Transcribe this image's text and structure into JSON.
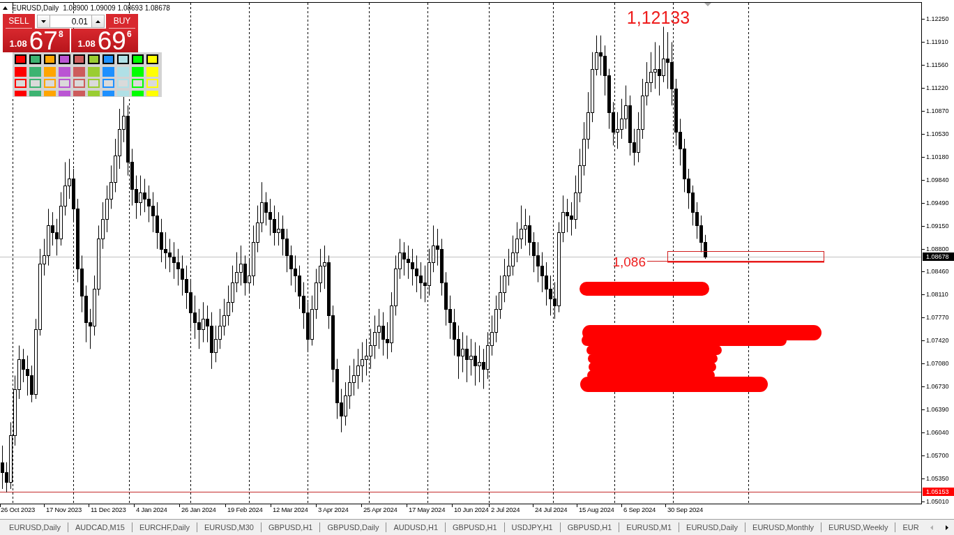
{
  "chart_header": {
    "symbol": "EURUSD,Daily",
    "ohlc": [
      "1.08900",
      "1.09009",
      "1.08693",
      "1.08678"
    ]
  },
  "one_click_trading": {
    "sell": {
      "label": "SELL",
      "price_prefix": "1.08",
      "price_main": "67",
      "price_fraction": "8"
    },
    "lot": {
      "value": "0.01"
    },
    "buy": {
      "label": "BUY",
      "price_prefix": "1.08",
      "price_main": "69",
      "price_fraction": "6"
    }
  },
  "palette": {
    "swatches": [
      {
        "color": "#ff0000"
      },
      {
        "color": "#3cb371"
      },
      {
        "color": "#ffa500"
      },
      {
        "color": "#ba55d3"
      },
      {
        "color": "#cd5c5c"
      },
      {
        "color": "#9acd32"
      },
      {
        "color": "#1e90ff"
      },
      {
        "color": "#b0e0e6"
      },
      {
        "color": "#00ff00"
      },
      {
        "color": "#ffff00"
      }
    ],
    "rows": [
      {
        "kind": "bordered"
      },
      {
        "kind": "solid"
      },
      {
        "kind": "frame"
      },
      {
        "kind": "strip"
      }
    ]
  },
  "chart": {
    "drawings": [
      {
        "kind": "text",
        "text": "1,12133"
      },
      {
        "kind": "rectangle",
        "label": "1,086"
      }
    ],
    "price_labels": [
      "1.12250",
      "1.11910",
      "1.11560",
      "1.11220",
      "1.10870",
      "1.10530",
      "1.10180",
      "1.09840",
      "1.09490",
      "1.09150",
      "1.08800",
      "1.08460",
      "1.08110",
      "1.07770",
      "1.07420",
      "1.07080",
      "1.06730",
      "1.06390",
      "1.06040",
      "1.05700",
      "1.05350",
      "1.05010"
    ],
    "price_tags": [
      {
        "kind": "bid",
        "label": "1.08678"
      },
      {
        "kind": "level",
        "label": "1.05153"
      }
    ],
    "date_labels": [
      "26 Oct 2023",
      "17 Nov 2023",
      "11 Dec 2023",
      "4 Jan 2024",
      "26 Jan 2024",
      "19 Feb 2024",
      "12 Mar 2024",
      "3 Apr 2024",
      "25 Apr 2024",
      "17 May 2024",
      "10 Jun 2024",
      "2 Jul 2024",
      "24 Jul 2024",
      "15 Aug 2024",
      "6 Sep 2024",
      "30 Sep 2024"
    ]
  },
  "tabs": [
    {
      "label": "EURUSD,Daily",
      "selected": false
    },
    {
      "label": "AUDCAD,M15",
      "selected": false
    },
    {
      "label": "EURCHF,Daily",
      "selected": false
    },
    {
      "label": "EURUSD,M30",
      "selected": false
    },
    {
      "label": "GBPUSD,H1",
      "selected": false
    },
    {
      "label": "GBPUSD,Daily",
      "selected": false
    },
    {
      "label": "AUDUSD,H1",
      "selected": false
    },
    {
      "label": "GBPUSD,H1",
      "selected": false
    },
    {
      "label": "USDJPY,H1",
      "selected": false
    },
    {
      "label": "GBPUSD,H1",
      "selected": false
    },
    {
      "label": "EURUSD,M1",
      "selected": false
    },
    {
      "label": "EURUSD,Daily",
      "selected": false
    },
    {
      "label": "EURUSD,Monthly",
      "selected": false
    },
    {
      "label": "EURUSD,Weekly",
      "selected": false
    },
    {
      "label": "EUR",
      "selected": false
    }
  ],
  "tab_scroll_buttons": [
    {
      "kind": "left",
      "disabled": true
    },
    {
      "kind": "right",
      "disabled": false
    }
  ]
}
